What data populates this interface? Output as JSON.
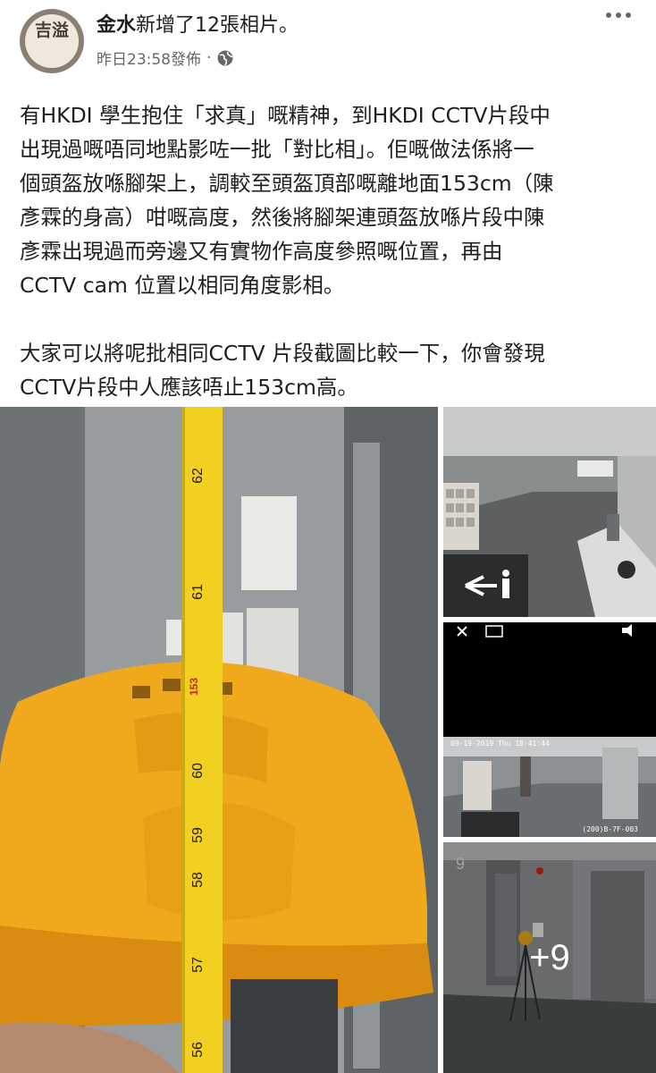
{
  "post": {
    "author_name": "金水",
    "action_text": "新增了12張相片。",
    "timestamp": "昨日23:58發佈",
    "separator": "·",
    "privacy_icon": "globe-icon",
    "more_icon": "more-icon"
  },
  "avatar": {
    "seal_text": "吉溢"
  },
  "body": {
    "paragraph_1": "有HKDI 學生抱住「求真」嘅精神，到HKDI CCTV片段中\n出現過嘅唔同地點影咗一批「對比相」。佢嘅做法係將一\n個頭盔放喺腳架上，調較至頭盔頂部嘅離地面153cm（陳\n彥霖的身高）咁嘅高度，然後將腳架連頭盔放喺片段中陳\n彥霖出現過而旁邊又有實物作高度參照嘅位置，再由\nCCTV cam 位置以相同角度影相。",
    "paragraph_2": "大家可以將呢批相同CCTV 片段截圖比較一下，你會發現\nCCTV片段中人應該唔止153cm高。"
  },
  "photos": {
    "more_count": "+9",
    "cctv_timestamp": "09-19-2019 Thu 18:41:44",
    "cctv_camera_id": "(200)B-7F-003",
    "tape_numbers": [
      "62",
      "61",
      "60",
      "59",
      "58",
      "57",
      "56"
    ],
    "tape_mark": "153",
    "floor_number": "9"
  },
  "colors": {
    "helmet": "#f0a81c",
    "tape": "#f2d022",
    "text": "#1c1e21",
    "meta": "#65676b"
  }
}
